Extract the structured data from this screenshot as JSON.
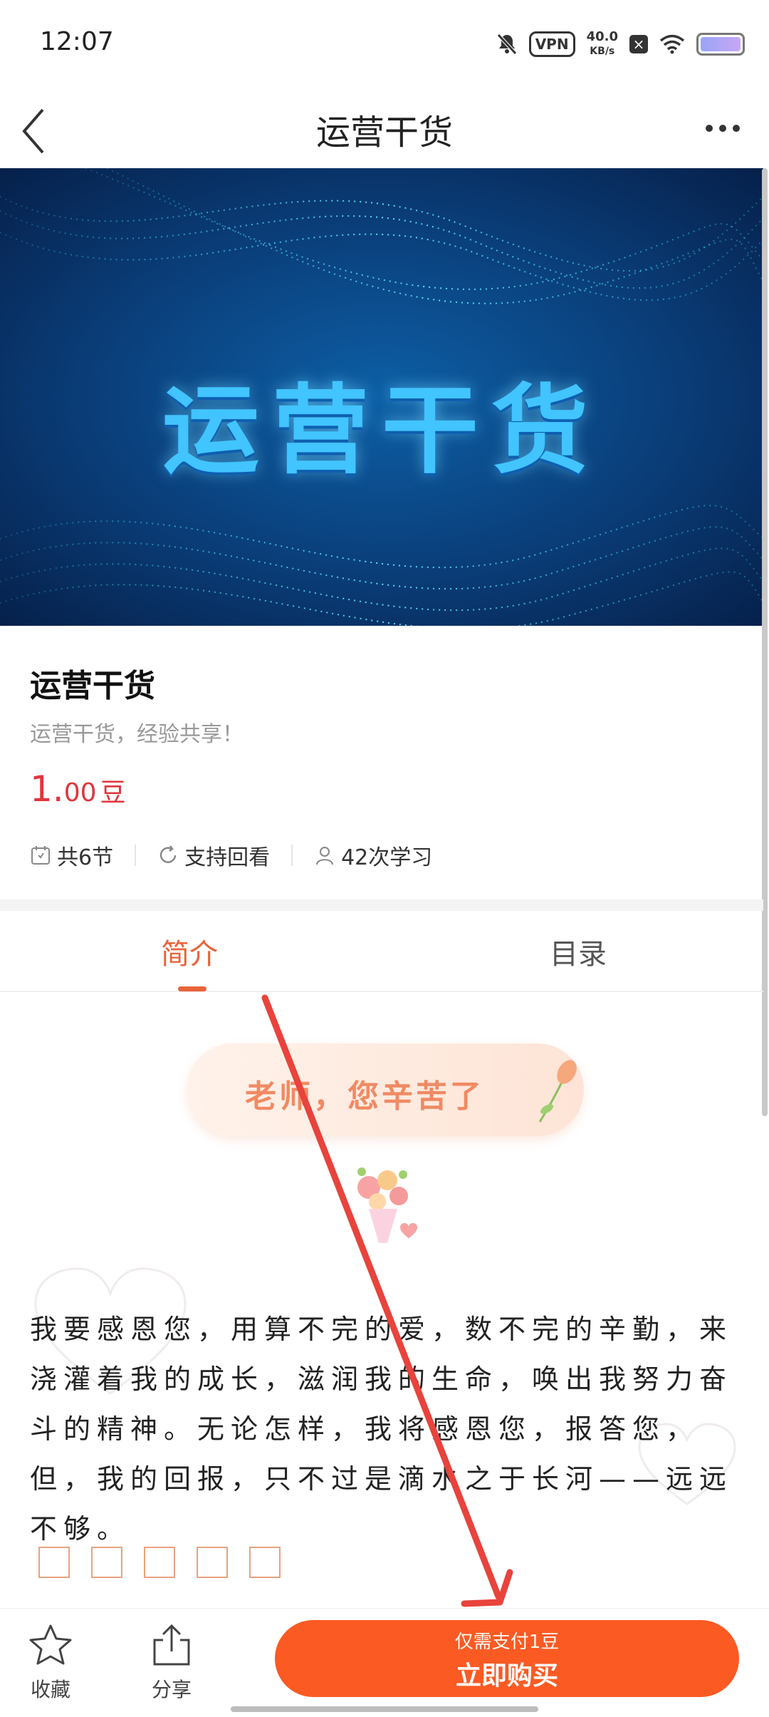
{
  "status_bar": {
    "time": "12:07",
    "vpn": "VPN",
    "speed_value": "40.0",
    "speed_unit": "KB/s",
    "icons": [
      "mute-bell-icon",
      "vpn-icon",
      "network-speed",
      "close-box-icon",
      "wifi-icon",
      "battery-icon"
    ]
  },
  "header": {
    "title": "运营干货",
    "back_icon": "chevron-left-icon",
    "more_icon": "more-dots-icon"
  },
  "banner": {
    "text": "运营干货"
  },
  "course": {
    "title": "运营干货",
    "subtitle": "运营干货，经验共享！",
    "price_int": "1.",
    "price_dec": "00",
    "price_unit": "豆",
    "meta": {
      "lessons": "共6节",
      "replay": "支持回看",
      "learners": "42次学习"
    }
  },
  "tabs": {
    "intro": "简介",
    "catalog": "目录",
    "active": "intro"
  },
  "content": {
    "thanks": "老师，您辛苦了",
    "paragraph": "我要感恩您，用算不完的爱，数不完的辛勤，来浇灌着我的成长，滋润我的生命，唤出我努力奋斗的精神。无论怎样，我将感恩您，报答您，但，我的回报，只不过是滴水之于长河——远远不够。"
  },
  "bottom_bar": {
    "favorite": "收藏",
    "share": "分享",
    "buy_sub": "仅需支付1豆",
    "buy_main": "立即购买"
  },
  "colors": {
    "accent": "#e8643a",
    "price": "#e0353e",
    "buy_button": "#fb5a23",
    "annotation_arrow": "#e8433c"
  }
}
